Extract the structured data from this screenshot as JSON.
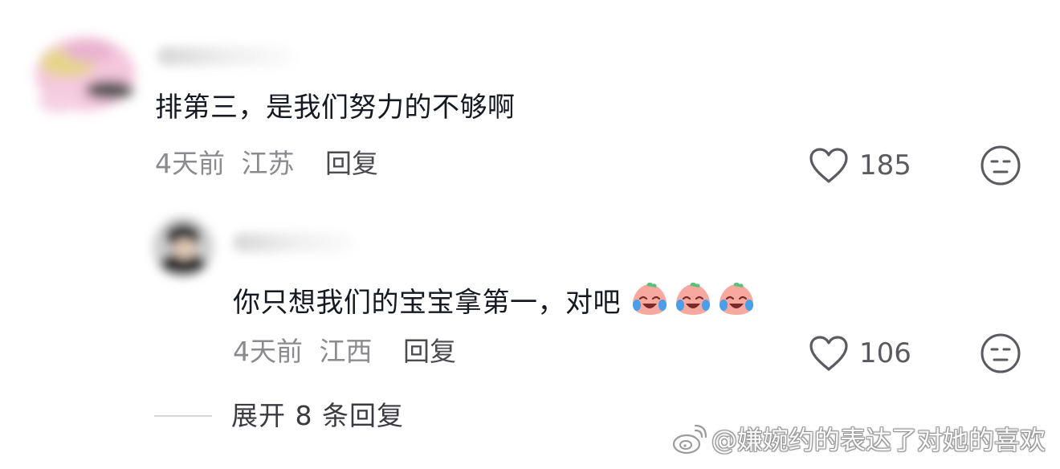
{
  "comments": [
    {
      "content": "排第三，是我们努力的不够啊",
      "time": "4天前",
      "location": "江苏",
      "reply_label": "回复",
      "likes": "185",
      "avatar_icon": "blurred-avatar-icon"
    },
    {
      "content": "你只想我们的宝宝拿第一，对吧",
      "time": "4天前",
      "location": "江西",
      "reply_label": "回复",
      "likes": "106",
      "avatar_icon": "blurred-avatar-icon",
      "emoji_icons": [
        "crying-laughing-peach-emoji",
        "crying-laughing-peach-emoji",
        "crying-laughing-peach-emoji"
      ]
    }
  ],
  "expand": {
    "label": "展开 8 条回复"
  },
  "watermark": {
    "text": "@嫌婉约的表达了对她的喜欢",
    "icon": "weibo-logo-icon"
  },
  "colors": {
    "text": "#161823",
    "meta": "#8a8a8f",
    "like": "#5a5a60"
  }
}
